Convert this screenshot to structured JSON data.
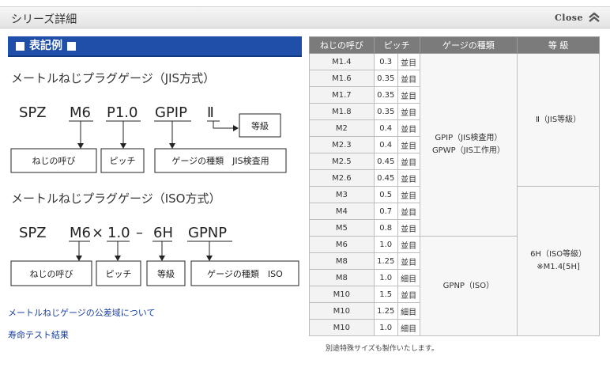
{
  "header": {
    "title": "シリーズ詳細",
    "close_label": "Close"
  },
  "legend": {
    "title": "表記例"
  },
  "jis_example": {
    "title": "メートルねじプラグゲージ（JIS方式）",
    "codes": [
      "SPZ",
      "M6",
      "P1.0",
      "GPIP",
      "Ⅱ"
    ],
    "labels": [
      "ねじの呼び",
      "ピッチ",
      "ゲージの種類　JIS検査用",
      "等級"
    ]
  },
  "iso_example": {
    "title": "メートルねじプラグゲージ（ISO方式）",
    "codes": [
      "SPZ",
      "M6",
      "×",
      "1.0",
      "–",
      "6H",
      "GPNP"
    ],
    "labels": [
      "ねじの呼び",
      "ピッチ",
      "等級",
      "ゲージの種類　ISO"
    ]
  },
  "links": {
    "tolerance": "メートルねじゲージの公差域について",
    "life_test": "寿命テスト結果"
  },
  "table": {
    "headers": [
      "ねじの呼び",
      "ピッチ",
      "ゲージの種類",
      "等 級"
    ],
    "rows": [
      [
        "M1.4",
        "0.3",
        "並目"
      ],
      [
        "M1.6",
        "0.35",
        "並目"
      ],
      [
        "M1.7",
        "0.35",
        "並目"
      ],
      [
        "M1.8",
        "0.35",
        "並目"
      ],
      [
        "M2",
        "0.4",
        "並目"
      ],
      [
        "M2.3",
        "0.4",
        "並目"
      ],
      [
        "M2.5",
        "0.45",
        "並目"
      ],
      [
        "M2.6",
        "0.45",
        "並目"
      ],
      [
        "M3",
        "0.5",
        "並目"
      ],
      [
        "M4",
        "0.7",
        "並目"
      ],
      [
        "M5",
        "0.8",
        "並目"
      ],
      [
        "M6",
        "1.0",
        "並目"
      ],
      [
        "M8",
        "1.25",
        "並目"
      ],
      [
        "M8",
        "1.0",
        "細目"
      ],
      [
        "M10",
        "1.5",
        "並目"
      ],
      [
        "M10",
        "1.25",
        "細目"
      ],
      [
        "M10",
        "1.0",
        "細目"
      ]
    ],
    "jis_gauge_1": "GPIP（JIS検査用）",
    "jis_gauge_2": "GPWP（JIS工作用）",
    "iso_gauge": "GPNP（ISO）",
    "jis_grade": "Ⅱ（JIS等級）",
    "iso_grade_1": "6H（ISO等級）",
    "iso_grade_2": "※M1.4[5H]"
  },
  "note": "別途特殊サイズも製作いたします。"
}
